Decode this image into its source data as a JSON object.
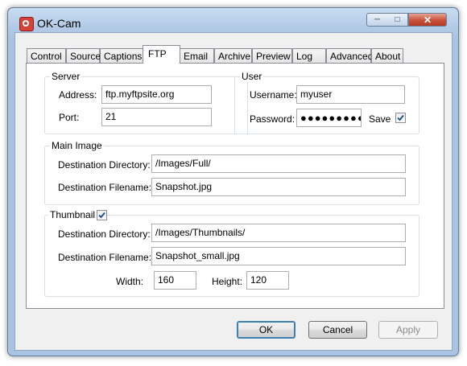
{
  "window": {
    "title": "OK-Cam",
    "controls": {
      "minimize": "─",
      "maximize": "□",
      "close": "✕"
    }
  },
  "tabs": [
    "Control",
    "Source",
    "Captions",
    "FTP",
    "Email",
    "Archive",
    "Preview",
    "Log",
    "Advanced",
    "About"
  ],
  "active_tab": "FTP",
  "server": {
    "legend": "Server",
    "address_label": "Address:",
    "address_value": "ftp.myftpsite.org",
    "port_label": "Port:",
    "port_value": "21"
  },
  "user": {
    "legend": "User",
    "username_label": "Username:",
    "username_value": "myuser",
    "password_label": "Password:",
    "password_value": "●●●●●●●●●●",
    "save_label": "Save",
    "save_checked": true
  },
  "main_image": {
    "legend": "Main Image",
    "dir_label": "Destination Directory:",
    "dir_value": "/Images/Full/",
    "file_label": "Destination Filename:",
    "file_value": "Snapshot.jpg"
  },
  "thumbnail": {
    "legend": "Thumbnail",
    "enabled": true,
    "dir_label": "Destination Directory:",
    "dir_value": "/Images/Thumbnails/",
    "file_label": "Destination Filename:",
    "file_value": "Snapshot_small.jpg",
    "width_label": "Width:",
    "width_value": "160",
    "height_label": "Height:",
    "height_value": "120"
  },
  "buttons": {
    "ok": "OK",
    "cancel": "Cancel",
    "apply": "Apply"
  },
  "colors": {
    "frame": "#a9c4e3",
    "close": "#c8513b",
    "check": "#1a4a8c"
  }
}
